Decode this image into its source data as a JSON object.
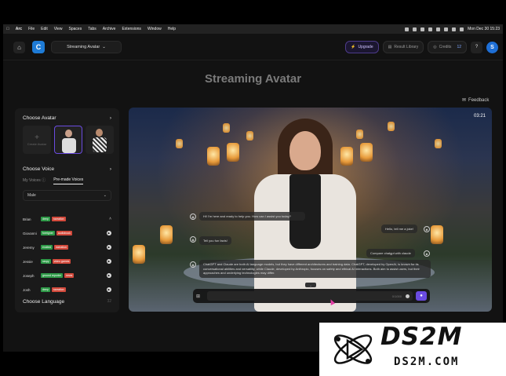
{
  "menubar": {
    "items": [
      "Arc",
      "File",
      "Edit",
      "View",
      "Spaces",
      "Tabs",
      "Archive",
      "Extensions",
      "Window",
      "Help"
    ],
    "clock": "Mon Dec 30  15:23"
  },
  "topbar": {
    "logo_letter": "C",
    "project": "Streaming Avatar",
    "upgrade": "Upgrade",
    "result_library": "Result Library",
    "credits_label": "Credits",
    "credits_value": "12",
    "help": "?",
    "user_initial": "S"
  },
  "page": {
    "title": "Streaming Avatar",
    "feedback": "Feedback"
  },
  "panel": {
    "choose_avatar": "Choose Avatar",
    "create_avatar": "Create Avatar",
    "choose_voice": "Choose Voice",
    "tab_my_voices": "My Voices",
    "tab_premade": "Pre-made Voices",
    "gender_select": "Male",
    "voices": [
      {
        "name": "Brian",
        "tags": [
          {
            "t": "deep",
            "c": "g"
          },
          {
            "t": "narration",
            "c": "r"
          }
        ],
        "action": "chevron"
      },
      {
        "name": "Giovanni",
        "tags": [
          {
            "t": "foreigner",
            "c": "g"
          },
          {
            "t": "audiobook",
            "c": "r"
          }
        ],
        "action": "play"
      },
      {
        "name": "Jeremy",
        "tags": [
          {
            "t": "excited",
            "c": "g"
          },
          {
            "t": "narration",
            "c": "r"
          }
        ],
        "action": "play"
      },
      {
        "name": "Jessie",
        "tags": [
          {
            "t": "raspy",
            "c": "g"
          },
          {
            "t": "video games",
            "c": "r"
          }
        ],
        "action": "play"
      },
      {
        "name": "Joseph",
        "tags": [
          {
            "t": "ground reporter",
            "c": "g"
          },
          {
            "t": "news",
            "c": "r"
          }
        ],
        "action": "play"
      },
      {
        "name": "Josh",
        "tags": [
          {
            "t": "deep",
            "c": "g"
          },
          {
            "t": "narration",
            "c": "r"
          }
        ],
        "action": "play"
      }
    ],
    "choose_language": "Choose Language",
    "language_count": "32"
  },
  "video": {
    "timer": "03:21",
    "messages": [
      {
        "who": "user",
        "text": "Hi! I'm here and ready to help you. How can I assist you today?"
      },
      {
        "who": "avatar",
        "text": "Tell you fun facts!"
      },
      {
        "who": "avatar",
        "text": "Hello, tell me a joke!"
      },
      {
        "who": "user",
        "text": "Compare chatgpt with claude"
      },
      {
        "who": "avatar",
        "text": "ChatGPT and Claude are both AI language models, but they have different architectures and training data. ChatGPT, developed by OpenAI, is known for its conversational abilities and versatility, while Claude, developed by Anthropic, focuses on safety and ethical AI interactions. Both aim to assist users, but their approaches and underlying technologies may differ."
      }
    ],
    "input_counter": "0/1000"
  },
  "watermark": {
    "big": "DS2M",
    "small": "DS2M.COM"
  }
}
